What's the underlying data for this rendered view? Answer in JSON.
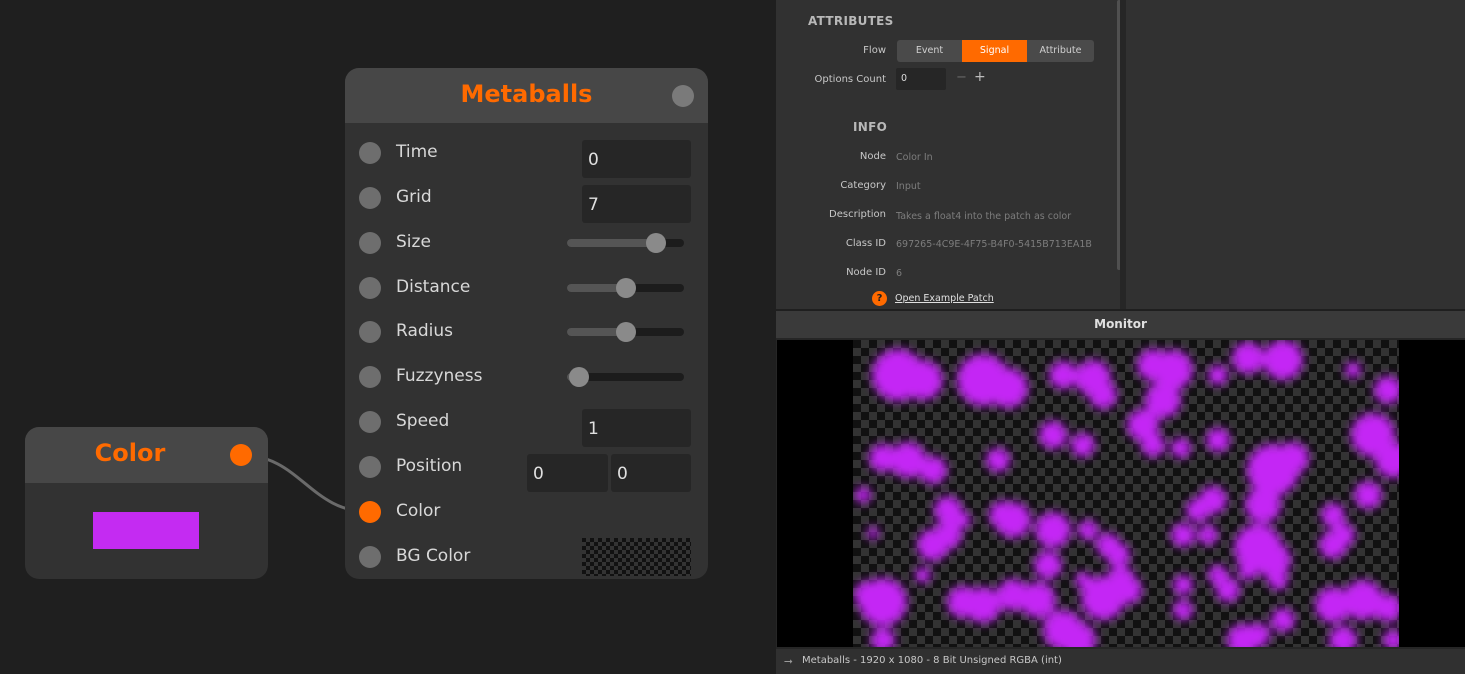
{
  "colors": {
    "accent": "#ff6a00",
    "metaball": "#c428f5",
    "color_swatch": "#c42bf2"
  },
  "color_node": {
    "title": "Color"
  },
  "metaballs_node": {
    "title": "Metaballs",
    "inputs": {
      "time": {
        "label": "Time",
        "value": "0"
      },
      "grid": {
        "label": "Grid",
        "value": "7"
      },
      "size": {
        "label": "Size",
        "level": 0.76
      },
      "distance": {
        "label": "Distance",
        "level": 0.5
      },
      "radius": {
        "label": "Radius",
        "level": 0.5
      },
      "fuzzyness": {
        "label": "Fuzzyness",
        "level": 0.1
      },
      "speed": {
        "label": "Speed",
        "value": "1"
      },
      "position": {
        "label": "Position",
        "x": "0",
        "y": "0"
      },
      "color": {
        "label": "Color"
      },
      "bg_color": {
        "label": "BG Color"
      }
    }
  },
  "inspector": {
    "attributes_title": "ATTRIBUTES",
    "flow_label": "Flow",
    "flow_options": [
      "Event",
      "Signal",
      "Attribute"
    ],
    "flow_selected": "Signal",
    "options_count_label": "Options Count",
    "options_count_value": "0",
    "minus": "−",
    "plus": "+",
    "info_title": "INFO",
    "info": {
      "node_label": "Node",
      "node_value": "Color In",
      "category_label": "Category",
      "category_value": "Input",
      "description_label": "Description",
      "description_value": "Takes a float4 into the patch as color",
      "class_id_label": "Class ID",
      "class_id_value": "697265-4C9E-4F75-B4F0-5415B713EA1B",
      "node_id_label": "Node ID",
      "node_id_value": "6"
    },
    "help_icon": "?",
    "example_link": "Open Example Patch"
  },
  "monitor": {
    "title": "Monitor",
    "status": "Metaballs - 1920 x 1080 - 8 Bit Unsigned RGBA (int)"
  }
}
